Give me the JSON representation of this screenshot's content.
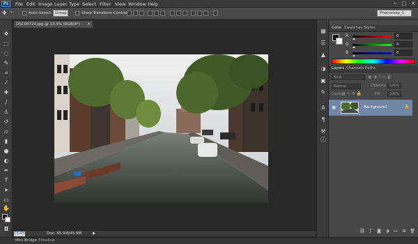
{
  "app": {
    "logo": "Ps"
  },
  "menu": [
    "File",
    "Edit",
    "Image",
    "Layer",
    "Type",
    "Select",
    "Filter",
    "View",
    "Window",
    "Help"
  ],
  "window_controls": [
    "−",
    "□",
    "✕"
  ],
  "options": {
    "auto_select_label": "Auto-Select:",
    "auto_select_value": "Group",
    "transform_label": "Show Transform Controls"
  },
  "workspace": "Photoshop_1",
  "document": {
    "tab_title": "DSC08724.jpg @ 13.4% (RGB/8*)",
    "close": "×"
  },
  "status": {
    "zoom": "13.4%",
    "doc_size": "Doc: 45.9M/45.9M",
    "arrow": "▶"
  },
  "bottom_tabs": [
    "Mini Bridge",
    "Timeline"
  ],
  "color_panel": {
    "tabs": [
      "Color",
      "Swatches",
      "Styles"
    ],
    "channels": [
      {
        "letter": "R",
        "value": "0",
        "color": "#e03030"
      },
      {
        "letter": "G",
        "value": "0",
        "color": "#30c030"
      },
      {
        "letter": "B",
        "value": "0",
        "color": "#3050e0"
      }
    ]
  },
  "layers_panel": {
    "tabs": [
      "Layers",
      "Channels",
      "Paths"
    ],
    "kind_label": "Kind",
    "blend_mode": "Normal",
    "opacity_label": "Opacity:",
    "opacity_value": "100%",
    "lock_label": "Lock:",
    "fill_label": "Fill:",
    "fill_value": "100%",
    "layer_name": "Background",
    "lock_icon": "🔒",
    "eye_icon": "◉"
  },
  "colors": {
    "accent": "#4a8fd1",
    "selected_layer": "#6f86a6"
  }
}
